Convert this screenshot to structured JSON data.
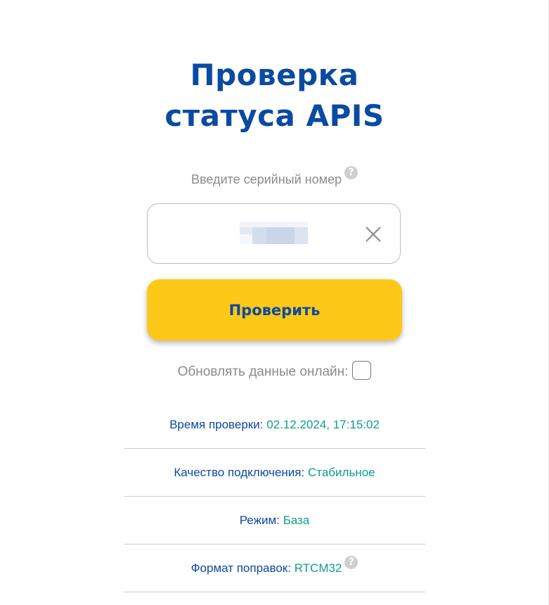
{
  "page": {
    "title_line1": "Проверка",
    "title_line2": "статуса APIS"
  },
  "serial": {
    "hint": "Введите серийный номер",
    "value": "",
    "help_icon": "question-circle-icon",
    "clear_icon": "close-icon"
  },
  "actions": {
    "check_label": "Проверить"
  },
  "online": {
    "label": "Обновлять данные онлайн:",
    "checked": false
  },
  "info": {
    "rows": [
      {
        "label": "Время проверки:",
        "value": "02.12.2024, 17:15:02"
      },
      {
        "label": "Качество подключения:",
        "value": "Стабильное"
      },
      {
        "label": "Режим:",
        "value": "База"
      },
      {
        "label": "Формат поправок:",
        "value": "RTCM32"
      }
    ]
  },
  "colors": {
    "title": "#0b4aa2",
    "button_bg": "#fdc817",
    "value": "#0f9e86",
    "hint": "#8b8b8b"
  }
}
